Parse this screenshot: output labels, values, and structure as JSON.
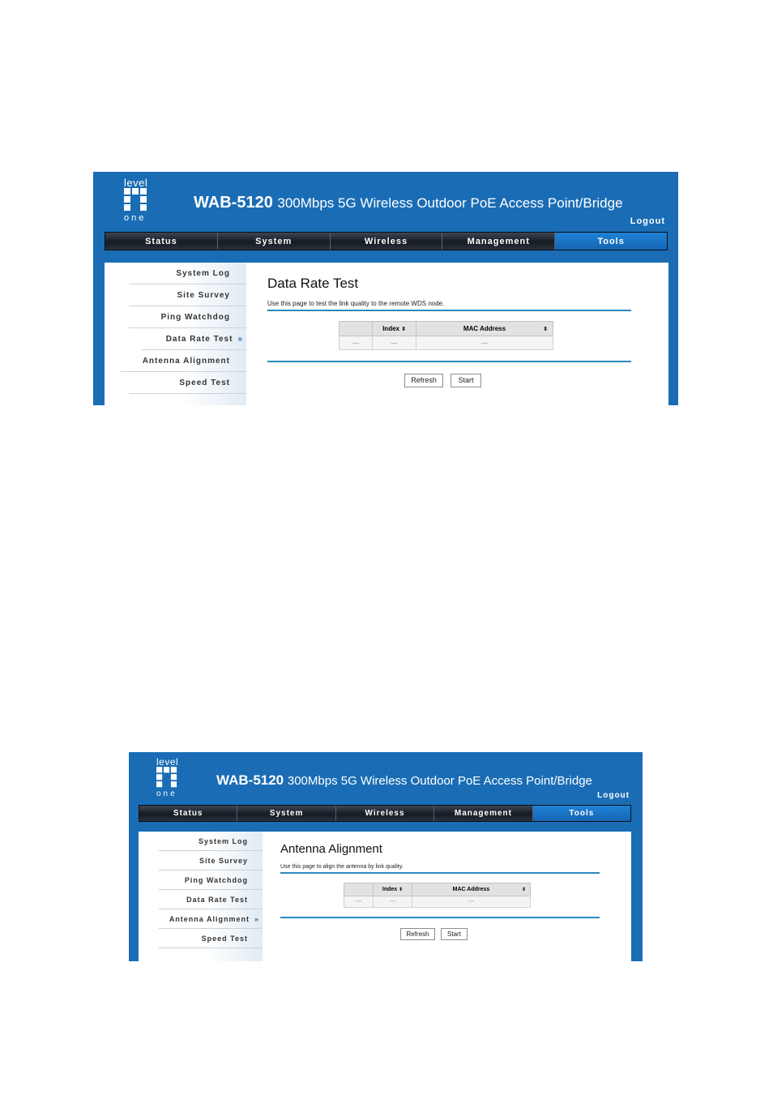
{
  "screens": [
    {
      "brand": {
        "logo_top": "level",
        "logo_bottom": "one"
      },
      "header": {
        "model": "WAB-5120",
        "description": "300Mbps 5G Wireless Outdoor PoE Access Point/Bridge",
        "logout": "Logout"
      },
      "nav": [
        "Status",
        "System",
        "Wireless",
        "Management",
        "Tools"
      ],
      "active_nav": "Tools",
      "sidebar": [
        "System Log",
        "Site Survey",
        "Ping Watchdog",
        "Data Rate Test",
        "Antenna Alignment",
        "Speed Test"
      ],
      "active_sidebar": "Data Rate Test",
      "active_marker": "»",
      "page": {
        "title": "Data Rate Test",
        "description": "Use this page to test the link quality to the remote WDS node."
      },
      "table": {
        "columns": [
          "",
          "Index",
          "MAC Address"
        ],
        "sort_icon": "⬍",
        "rows": [
          [
            "---",
            "---",
            "---"
          ]
        ]
      },
      "buttons": {
        "refresh": "Refresh",
        "start": "Start"
      }
    },
    {
      "brand": {
        "logo_top": "level",
        "logo_bottom": "one"
      },
      "header": {
        "model": "WAB-5120",
        "description": "300Mbps 5G Wireless Outdoor PoE Access Point/Bridge",
        "logout": "Logout"
      },
      "nav": [
        "Status",
        "System",
        "Wireless",
        "Management",
        "Tools"
      ],
      "active_nav": "Tools",
      "sidebar": [
        "System Log",
        "Site Survey",
        "Ping Watchdog",
        "Data Rate Test",
        "Antenna Alignment",
        "Speed Test"
      ],
      "active_sidebar": "Antenna Alignment",
      "active_marker": "»",
      "page": {
        "title": "Antenna Alignment",
        "description": "Use this page to align the antenna by link quality."
      },
      "table": {
        "columns": [
          "",
          "Index",
          "MAC Address"
        ],
        "sort_icon": "⬍",
        "rows": [
          [
            "---",
            "---",
            "---"
          ]
        ]
      },
      "buttons": {
        "refresh": "Refresh",
        "start": "Start"
      }
    }
  ],
  "colors": {
    "brand_blue": "#1a6db5",
    "nav_dark": "#1e242c",
    "nav_active": "#1a75c6",
    "rule": "#2a8ac0"
  }
}
